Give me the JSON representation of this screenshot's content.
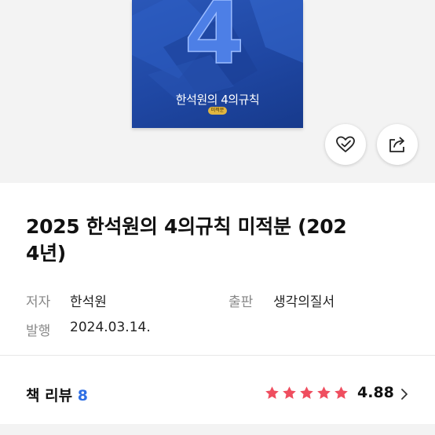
{
  "cover": {
    "big_digit": "4",
    "title": "한석원의 4의규칙",
    "badge": "미적분"
  },
  "actions": {
    "like_icon": "heart-check-icon",
    "share_icon": "share-icon"
  },
  "book": {
    "title": "2025 한석원의 4의규칙 미적분 (2024년)",
    "title_line1": "2025 한석원의 4의규칙 미적분 (202",
    "title_line2": "4년)"
  },
  "meta": {
    "author_label": "저자",
    "author_value": "한석원",
    "publisher_label": "출판",
    "publisher_value": "생각의질서",
    "date_label": "발행",
    "date_value": "2024.03.14."
  },
  "review": {
    "label": "책 리뷰",
    "count": "8",
    "stars": 5,
    "rating": "4.88",
    "colors": {
      "star": "#ef4e5f",
      "count": "#2f6fe4"
    }
  }
}
